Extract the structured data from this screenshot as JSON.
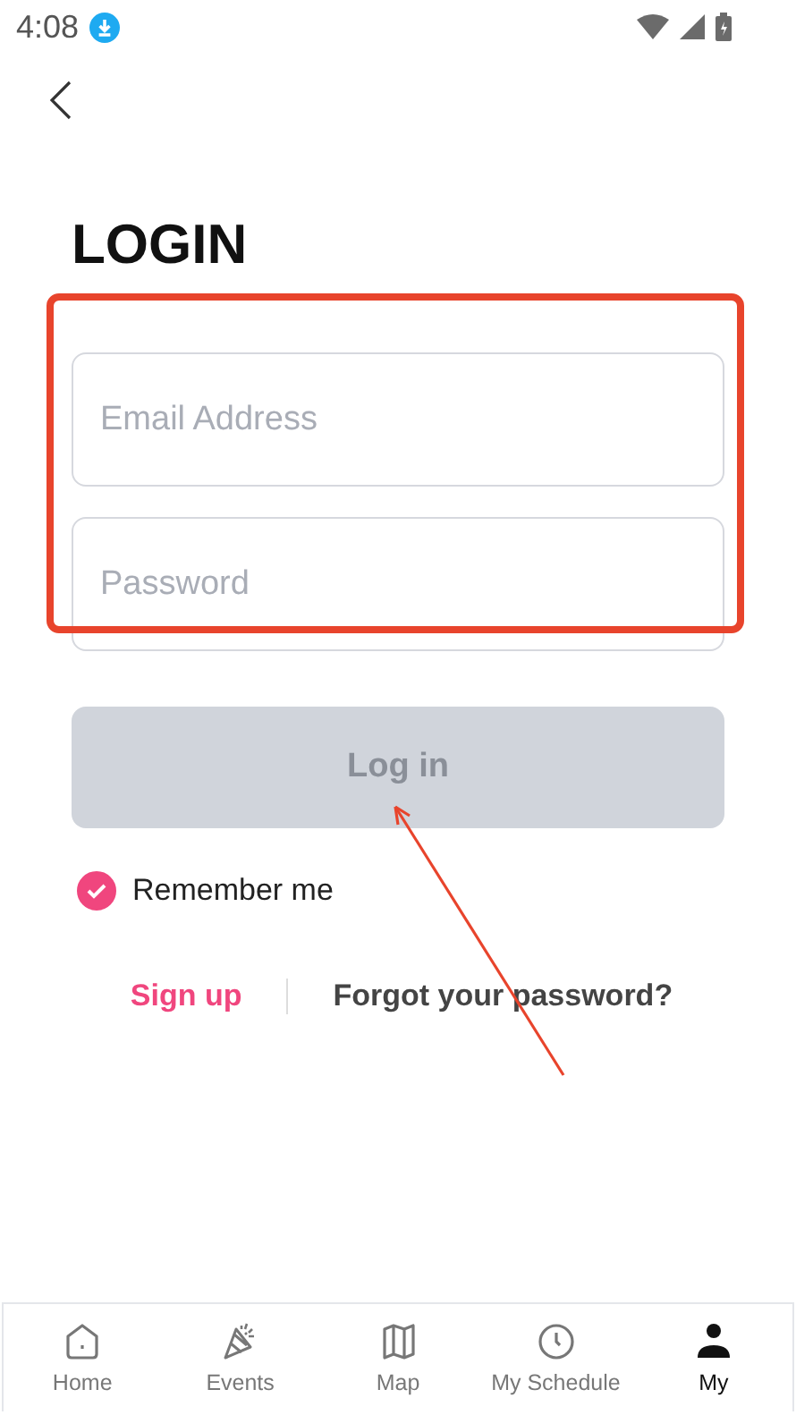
{
  "status_bar": {
    "time": "4:08"
  },
  "title": "LOGIN",
  "fields": [
    {
      "placeholder": "Email Address"
    },
    {
      "placeholder": "Password"
    }
  ],
  "login_button": {
    "label": "Log in",
    "disabled": true
  },
  "remember": {
    "label": "Remember me",
    "checked": true
  },
  "links": [
    {
      "label": "Sign up",
      "kind": "accent"
    },
    {
      "label": "Forgot your password?",
      "kind": "plain"
    }
  ],
  "nav": [
    {
      "label": "Home",
      "selected": false
    },
    {
      "label": "Events",
      "selected": false
    },
    {
      "label": "Map",
      "selected": false
    },
    {
      "label": "My Schedule",
      "selected": false
    },
    {
      "label": "My",
      "selected": true
    }
  ]
}
